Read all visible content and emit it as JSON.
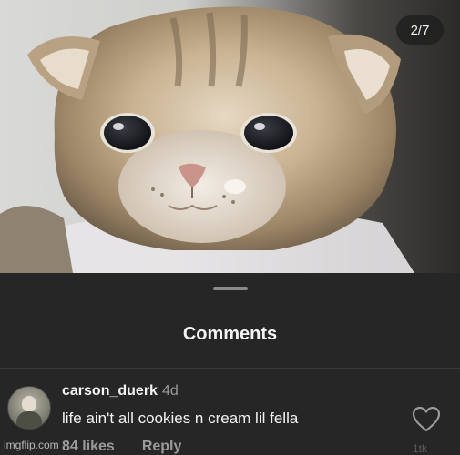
{
  "post": {
    "image_counter": "2/7"
  },
  "comments_sheet": {
    "title": "Comments",
    "items": [
      {
        "username": "carson_duerk",
        "time": "4d",
        "text": "life ain't all cookies n cream lil fella",
        "likes": "84 likes",
        "reply_label": "Reply",
        "like_count_side": "1tk"
      }
    ]
  },
  "watermark": "imgflip.com",
  "colors": {
    "background": "#262626",
    "text_primary": "#f2f2f2",
    "text_secondary": "#9a9a9a"
  },
  "icons": [
    "heart-icon"
  ]
}
